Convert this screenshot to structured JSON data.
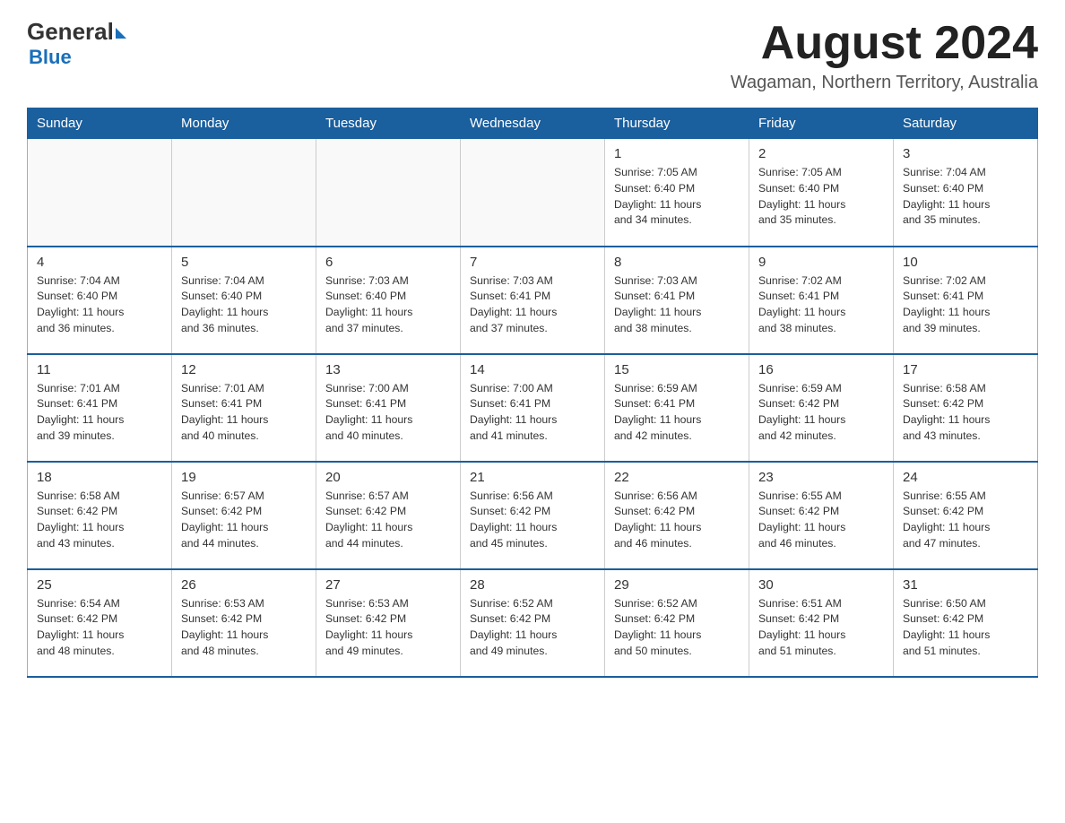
{
  "header": {
    "logo_general": "General",
    "logo_blue": "Blue",
    "month_title": "August 2024",
    "location": "Wagaman, Northern Territory, Australia"
  },
  "weekdays": [
    "Sunday",
    "Monday",
    "Tuesday",
    "Wednesday",
    "Thursday",
    "Friday",
    "Saturday"
  ],
  "weeks": [
    [
      {
        "day": "",
        "info": ""
      },
      {
        "day": "",
        "info": ""
      },
      {
        "day": "",
        "info": ""
      },
      {
        "day": "",
        "info": ""
      },
      {
        "day": "1",
        "info": "Sunrise: 7:05 AM\nSunset: 6:40 PM\nDaylight: 11 hours\nand 34 minutes."
      },
      {
        "day": "2",
        "info": "Sunrise: 7:05 AM\nSunset: 6:40 PM\nDaylight: 11 hours\nand 35 minutes."
      },
      {
        "day": "3",
        "info": "Sunrise: 7:04 AM\nSunset: 6:40 PM\nDaylight: 11 hours\nand 35 minutes."
      }
    ],
    [
      {
        "day": "4",
        "info": "Sunrise: 7:04 AM\nSunset: 6:40 PM\nDaylight: 11 hours\nand 36 minutes."
      },
      {
        "day": "5",
        "info": "Sunrise: 7:04 AM\nSunset: 6:40 PM\nDaylight: 11 hours\nand 36 minutes."
      },
      {
        "day": "6",
        "info": "Sunrise: 7:03 AM\nSunset: 6:40 PM\nDaylight: 11 hours\nand 37 minutes."
      },
      {
        "day": "7",
        "info": "Sunrise: 7:03 AM\nSunset: 6:41 PM\nDaylight: 11 hours\nand 37 minutes."
      },
      {
        "day": "8",
        "info": "Sunrise: 7:03 AM\nSunset: 6:41 PM\nDaylight: 11 hours\nand 38 minutes."
      },
      {
        "day": "9",
        "info": "Sunrise: 7:02 AM\nSunset: 6:41 PM\nDaylight: 11 hours\nand 38 minutes."
      },
      {
        "day": "10",
        "info": "Sunrise: 7:02 AM\nSunset: 6:41 PM\nDaylight: 11 hours\nand 39 minutes."
      }
    ],
    [
      {
        "day": "11",
        "info": "Sunrise: 7:01 AM\nSunset: 6:41 PM\nDaylight: 11 hours\nand 39 minutes."
      },
      {
        "day": "12",
        "info": "Sunrise: 7:01 AM\nSunset: 6:41 PM\nDaylight: 11 hours\nand 40 minutes."
      },
      {
        "day": "13",
        "info": "Sunrise: 7:00 AM\nSunset: 6:41 PM\nDaylight: 11 hours\nand 40 minutes."
      },
      {
        "day": "14",
        "info": "Sunrise: 7:00 AM\nSunset: 6:41 PM\nDaylight: 11 hours\nand 41 minutes."
      },
      {
        "day": "15",
        "info": "Sunrise: 6:59 AM\nSunset: 6:41 PM\nDaylight: 11 hours\nand 42 minutes."
      },
      {
        "day": "16",
        "info": "Sunrise: 6:59 AM\nSunset: 6:42 PM\nDaylight: 11 hours\nand 42 minutes."
      },
      {
        "day": "17",
        "info": "Sunrise: 6:58 AM\nSunset: 6:42 PM\nDaylight: 11 hours\nand 43 minutes."
      }
    ],
    [
      {
        "day": "18",
        "info": "Sunrise: 6:58 AM\nSunset: 6:42 PM\nDaylight: 11 hours\nand 43 minutes."
      },
      {
        "day": "19",
        "info": "Sunrise: 6:57 AM\nSunset: 6:42 PM\nDaylight: 11 hours\nand 44 minutes."
      },
      {
        "day": "20",
        "info": "Sunrise: 6:57 AM\nSunset: 6:42 PM\nDaylight: 11 hours\nand 44 minutes."
      },
      {
        "day": "21",
        "info": "Sunrise: 6:56 AM\nSunset: 6:42 PM\nDaylight: 11 hours\nand 45 minutes."
      },
      {
        "day": "22",
        "info": "Sunrise: 6:56 AM\nSunset: 6:42 PM\nDaylight: 11 hours\nand 46 minutes."
      },
      {
        "day": "23",
        "info": "Sunrise: 6:55 AM\nSunset: 6:42 PM\nDaylight: 11 hours\nand 46 minutes."
      },
      {
        "day": "24",
        "info": "Sunrise: 6:55 AM\nSunset: 6:42 PM\nDaylight: 11 hours\nand 47 minutes."
      }
    ],
    [
      {
        "day": "25",
        "info": "Sunrise: 6:54 AM\nSunset: 6:42 PM\nDaylight: 11 hours\nand 48 minutes."
      },
      {
        "day": "26",
        "info": "Sunrise: 6:53 AM\nSunset: 6:42 PM\nDaylight: 11 hours\nand 48 minutes."
      },
      {
        "day": "27",
        "info": "Sunrise: 6:53 AM\nSunset: 6:42 PM\nDaylight: 11 hours\nand 49 minutes."
      },
      {
        "day": "28",
        "info": "Sunrise: 6:52 AM\nSunset: 6:42 PM\nDaylight: 11 hours\nand 49 minutes."
      },
      {
        "day": "29",
        "info": "Sunrise: 6:52 AM\nSunset: 6:42 PM\nDaylight: 11 hours\nand 50 minutes."
      },
      {
        "day": "30",
        "info": "Sunrise: 6:51 AM\nSunset: 6:42 PM\nDaylight: 11 hours\nand 51 minutes."
      },
      {
        "day": "31",
        "info": "Sunrise: 6:50 AM\nSunset: 6:42 PM\nDaylight: 11 hours\nand 51 minutes."
      }
    ]
  ]
}
